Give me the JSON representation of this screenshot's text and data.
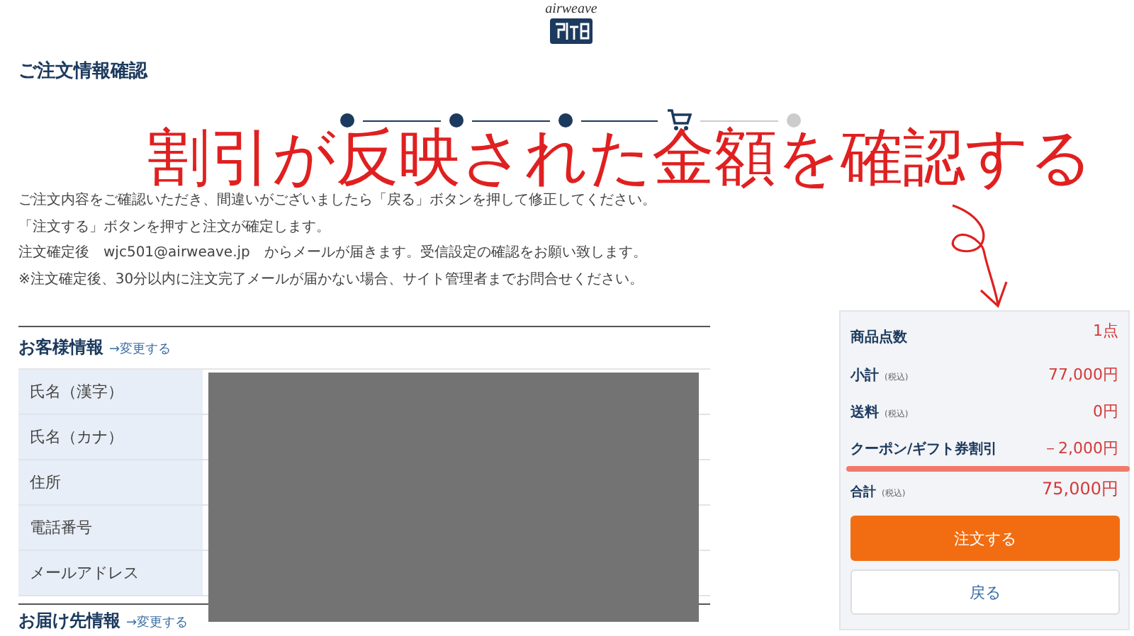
{
  "logo": {
    "wordmark": "airweave"
  },
  "page_title": "ご注文情報確認",
  "steps": [
    {
      "kind": "done"
    },
    {
      "kind": "done"
    },
    {
      "kind": "done"
    },
    {
      "kind": "current"
    },
    {
      "kind": "todo"
    }
  ],
  "annotation": {
    "text": "割引が反映された金額を確認する"
  },
  "notice_lines": [
    "ご注文内容をご確認いただき、間違いがございましたら「戻る」ボタンを押して修正してください。",
    "「注文する」ボタンを押すと注文が確定します。",
    "注文確定後　wjc501@airweave.jp　からメールが届きます。受信設定の確認をお願い致します。",
    "※注文確定後、30分以内に注文完了メールが届かない場合、サイト管理者までお問合せください。"
  ],
  "customer_section": {
    "heading": "お客様情報",
    "change_link": "→変更する",
    "field_labels": [
      "氏名（漢字）",
      "氏名（カナ）",
      "住所",
      "電話番号",
      "メールアドレス"
    ]
  },
  "shipping_section": {
    "heading": "お届け先情報",
    "change_link": "→変更する"
  },
  "summary": {
    "rows": [
      {
        "label": "商品点数",
        "value": "1点",
        "highlighted": false
      },
      {
        "label": "小計",
        "note": "(税込)",
        "value": "77,000円",
        "highlighted": false
      },
      {
        "label": "送料",
        "note": "(税込)",
        "value": "0円",
        "highlighted": false
      },
      {
        "label": "クーポン/ギフト券割引",
        "value": "－2,000円",
        "highlighted": true
      }
    ],
    "total": {
      "label": "合計",
      "note": "(税込)",
      "value": "75,000円"
    },
    "buttons": [
      {
        "kind": "primary",
        "label": "注文する"
      },
      {
        "kind": "secondary",
        "label": "戻る"
      }
    ]
  }
}
